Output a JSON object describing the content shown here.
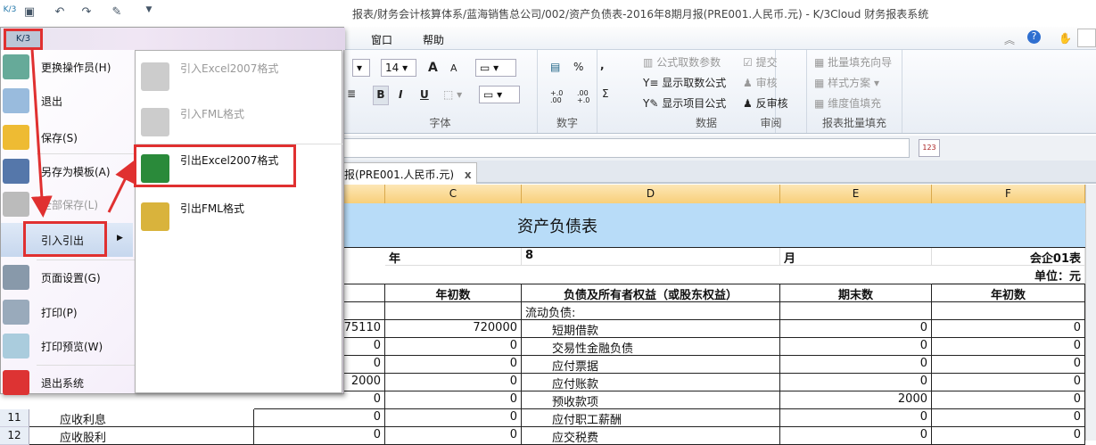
{
  "window_title": "报表/财务会计核算体系/蓝海销售总公司/002/资产负债表-2016年8期月报(PRE001.人民币.元) - K/3Cloud 财务报表系统",
  "quick_access": [
    "k3-logo",
    "save-icon",
    "undo-icon",
    "redo-icon",
    "eraser-icon",
    "customize-icon"
  ],
  "menubar": {
    "items": [
      "窗口",
      "帮助"
    ]
  },
  "app_button": "K/3",
  "ribbon": {
    "font": {
      "size": "14",
      "label": "字体",
      "bold": "B",
      "italic": "I",
      "underline": "U",
      "grow": "A",
      "shrink": "A"
    },
    "number": {
      "label": "数字",
      "percent": "%",
      "comma": ",",
      "sum": "Σ",
      "inc": "+.0 .00",
      "dec": ".00 +.0"
    },
    "data": {
      "label": "数据",
      "items": [
        "公式取数参数",
        "显示取数公式",
        "显示项目公式"
      ]
    },
    "review": {
      "label": "审阅",
      "items": [
        "提交",
        "审核",
        "反审核"
      ]
    },
    "batch": {
      "label": "报表批量填充",
      "items": [
        "批量填充向导",
        "样式方案",
        "维度值填充"
      ]
    }
  },
  "tab": {
    "label": "报(PRE001.人民币.元)",
    "close": "x"
  },
  "columns": [
    "C",
    "D",
    "E",
    "F"
  ],
  "sheet": {
    "title": "资产负债表",
    "year_label": "年",
    "period": "8",
    "month_label": "月",
    "form_code": "会企01表",
    "unit": "单位：元",
    "headers": {
      "b_begin": "年初数",
      "liab": "负债及所有者权益（或股东权益）",
      "end": "期末数",
      "begin": "年初数"
    },
    "section": "流动负债:",
    "rows": [
      {
        "b": "75110",
        "c": "720000",
        "d": "短期借款",
        "e": "0",
        "f": "0"
      },
      {
        "b": "0",
        "c": "0",
        "d": "交易性金融负债",
        "e": "0",
        "f": "0"
      },
      {
        "b": "0",
        "c": "0",
        "d": "应付票据",
        "e": "0",
        "f": "0"
      },
      {
        "b": "2000",
        "c": "0",
        "d": "应付账款",
        "e": "0",
        "f": "0"
      },
      {
        "b": "0",
        "c": "0",
        "d": "预收款项",
        "e": "2000",
        "f": "0"
      },
      {
        "n": "11",
        "a": "应收利息",
        "b": "0",
        "c": "0",
        "d": "应付职工薪酬",
        "e": "0",
        "f": "0"
      },
      {
        "n": "12",
        "a": "应收股利",
        "b": "0",
        "c": "0",
        "d": "应交税费",
        "e": "0",
        "f": "0"
      }
    ]
  },
  "file_menu": {
    "items": [
      {
        "label": "更换操作员(H)"
      },
      {
        "label": "退出"
      },
      {
        "label": "保存(S)"
      },
      {
        "label": "另存为模板(A)"
      },
      {
        "label": "全部保存(L)",
        "disabled": true
      },
      {
        "label": "引入引出",
        "selected": true
      },
      {
        "label": "页面设置(G)"
      },
      {
        "label": "打印(P)"
      },
      {
        "label": "打印预览(W)"
      },
      {
        "label": "退出系统"
      }
    ],
    "submenu": [
      {
        "label": "引入Excel2007格式",
        "disabled": true
      },
      {
        "label": "引入FML格式",
        "disabled": true
      },
      {
        "label": "引出Excel2007格式"
      },
      {
        "label": "引出FML格式"
      }
    ]
  },
  "colors": {
    "highlight": "#e03030",
    "title_bg": "#b8dcf8",
    "col_header": "#f8cf7a"
  }
}
